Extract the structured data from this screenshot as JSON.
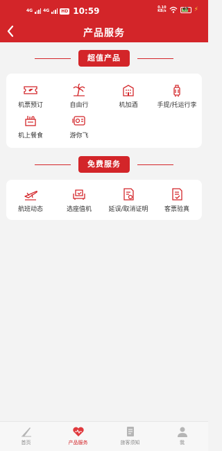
{
  "status_bar": {
    "network_1": "4G",
    "network_2": "4G",
    "hd_label": "HD",
    "time": "10:59",
    "speed_value": "0.10",
    "speed_unit": "KB/s",
    "battery": "67"
  },
  "header": {
    "title": "产品服务",
    "back_icon": "chevron-left-icon"
  },
  "premium_section": {
    "title": "超值产品",
    "items": [
      {
        "label": "机票预订",
        "icon": "ticket-icon"
      },
      {
        "label": "自由行",
        "icon": "palm-tree-icon"
      },
      {
        "label": "机加酒",
        "icon": "hotel-icon"
      },
      {
        "label": "手提/托运行李",
        "icon": "luggage-icon"
      },
      {
        "label": "机上餐食",
        "icon": "meal-icon"
      },
      {
        "label": "游你飞",
        "icon": "travel-pass-icon"
      }
    ]
  },
  "free_section": {
    "title": "免费服务",
    "items": [
      {
        "label": "航班动态",
        "icon": "plane-icon"
      },
      {
        "label": "选座值机",
        "icon": "seat-icon"
      },
      {
        "label": "延误/取消证明",
        "icon": "certificate-icon"
      },
      {
        "label": "客票验真",
        "icon": "verify-icon"
      }
    ]
  },
  "tab_bar": {
    "active": 1,
    "tabs": [
      {
        "label": "首页",
        "icon": "home-plane-icon"
      },
      {
        "label": "产品服务",
        "icon": "heart-icon"
      },
      {
        "label": "旅客须知",
        "icon": "notice-icon"
      },
      {
        "label": "我",
        "icon": "user-icon"
      }
    ]
  },
  "colors": {
    "brand": "#d32529",
    "background": "#f3f3f3"
  }
}
